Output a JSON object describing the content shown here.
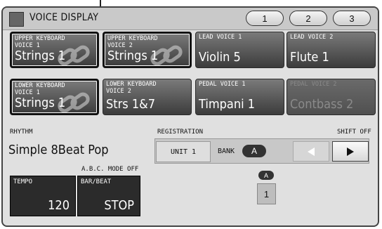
{
  "header": {
    "title": "VOICE DISPLAY",
    "tabs": [
      "1",
      "2",
      "3"
    ]
  },
  "voices": [
    {
      "category": "UPPER KEYBOARD\nVOICE 1",
      "name": "Strings 1",
      "selected": true,
      "linked": true
    },
    {
      "category": "UPPER KEYBOARD\nVOICE 2",
      "name": "Strings 1",
      "selected": true,
      "linked": true
    },
    {
      "category": "LEAD VOICE 1",
      "name": "Violin 5",
      "selected": false,
      "linked": false
    },
    {
      "category": "LEAD VOICE 2",
      "name": "Flute 1",
      "selected": false,
      "linked": false
    },
    {
      "category": "LOWER KEYBOARD\nVOICE 1",
      "name": "Strings 1",
      "selected": true,
      "linked": true
    },
    {
      "category": "LOWER KEYBOARD\nVOICE 2",
      "name": "Strs 1&7",
      "selected": false,
      "linked": false
    },
    {
      "category": "PEDAL VOICE 1",
      "name": "Timpani 1",
      "selected": false,
      "linked": false
    },
    {
      "category": "PEDAL VOICE 2",
      "name": "Contbass 2",
      "selected": false,
      "linked": false,
      "disabled": true
    }
  ],
  "rhythm": {
    "label": "RHYTHM",
    "name": "Simple 8Beat Pop",
    "abc_mode": "A.B.C. MODE OFF",
    "tempo_label": "TEMPO",
    "tempo_value": "120",
    "barbeat_label": "BAR/BEAT",
    "barbeat_value": "STOP"
  },
  "registration": {
    "label": "REGISTRATION",
    "shift": "SHIFT OFF",
    "unit": "UNIT 1",
    "bank_label": "BANK",
    "bank_value": "A",
    "bank_chip": "A",
    "memory_number": "1"
  }
}
